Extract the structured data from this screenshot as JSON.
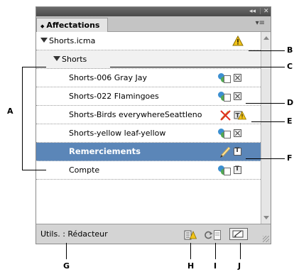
{
  "panel": {
    "title": "Affectations",
    "tab_arrows": "◆",
    "collapse_glyph": "◂◂",
    "close_glyph": "✕",
    "menu_glyph": "▾≡"
  },
  "rows": [
    {
      "label": "Shorts.icma"
    },
    {
      "label": "Shorts"
    },
    {
      "label": "Shorts-006 Gray Jay"
    },
    {
      "label": "Shorts-022 Flamingoes"
    },
    {
      "label": "Shorts-Birds everywhereSeattleno"
    },
    {
      "label": "Shorts-yellow leaf-yellow"
    },
    {
      "label": "Remerciements"
    },
    {
      "label": "Compte"
    }
  ],
  "footer": {
    "user_label": "Utils. : Rédacteur"
  },
  "callouts": {
    "A": "A",
    "B": "B",
    "C": "C",
    "D": "D",
    "E": "E",
    "F": "F",
    "G": "G",
    "H": "H",
    "I": "I",
    "J": "J"
  },
  "colors": {
    "selection": "#5b86b8",
    "warning": "#f2c418",
    "pencil": "#e6b94c"
  }
}
